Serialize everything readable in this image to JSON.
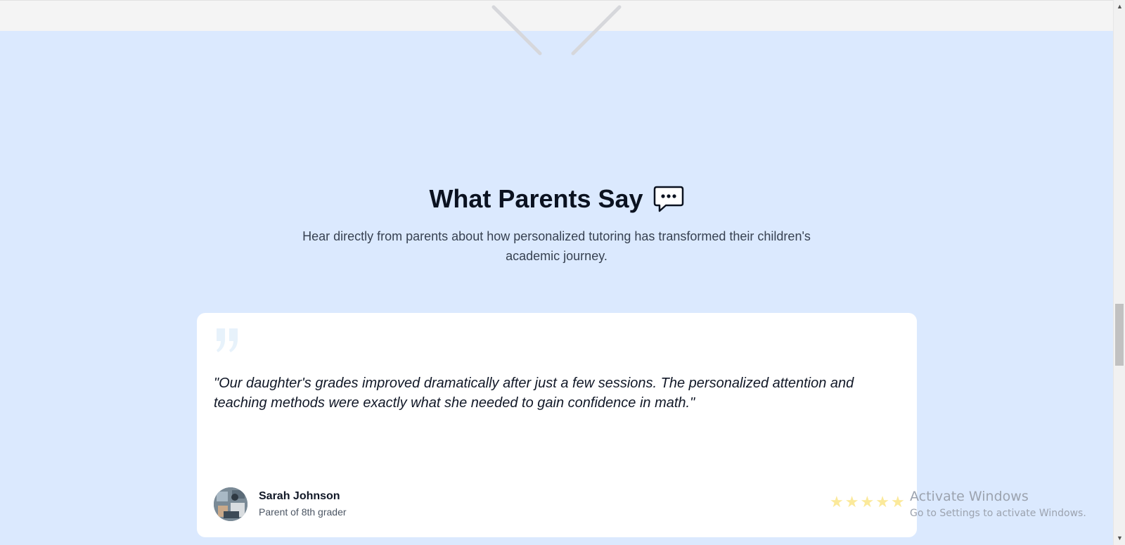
{
  "section": {
    "title": "What Parents Say",
    "subtitle": "Hear directly from parents about how personalized tutoring has transformed their children's academic journey."
  },
  "testimonial": {
    "quote": "\"Our daughter's grades improved dramatically after just a few sessions. The personalized attention and teaching methods were exactly what she needed to gain confidence in math.\"",
    "author_name": "Sarah Johnson",
    "author_role": "Parent of 8th grader",
    "rating": 5,
    "rating_max": 5
  },
  "stars": [
    "★",
    "★",
    "★",
    "★",
    "★"
  ],
  "watermark": {
    "title": "Activate Windows",
    "subtitle": "Go to Settings to activate Windows."
  },
  "scrollbar": {
    "up_arrow": "▲",
    "down_arrow": "▼"
  },
  "icons": {
    "section_icon": "speech-bubble-icon",
    "quote_icon": "quote-mark-icon",
    "top_icon": "chevron-down-icon"
  },
  "colors": {
    "section_background": "#dbe9fe",
    "card_background": "#ffffff",
    "heading": "#0b1220",
    "star": "#fbe99a"
  }
}
